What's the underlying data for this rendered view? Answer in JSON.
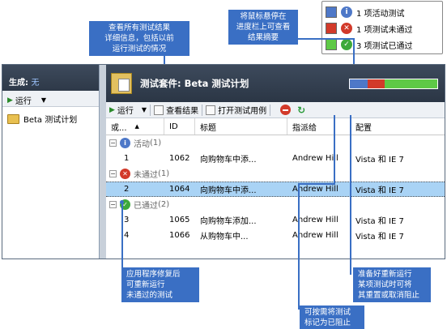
{
  "legend": {
    "items": [
      {
        "label": "1 项活动测试",
        "swatch": "#4e78c8",
        "icon": "i",
        "icon_color": "#4e78c8"
      },
      {
        "label": "1 项测试未通过",
        "swatch": "#d23a2a",
        "icon": "x",
        "icon_color": "#d23a2a"
      },
      {
        "label": "3 项测试已通过",
        "swatch": "#5ec946",
        "icon": "check",
        "icon_color": "#3da93a"
      }
    ]
  },
  "callouts": {
    "view_results": "查看所有测试结果\n详细信息，包括以前\n运行测试的情况",
    "hover_progress": "将鼠标悬停在\n进度栏上可查看\n结果摘要",
    "rerun": "应用程序修复后\n可重新运行\n未通过的测试",
    "blocked": "可按需将测试\n标记为已阻止",
    "reset": "准备好重新运行\n某项测试时可将\n其重置或取消阻止"
  },
  "left": {
    "build_label": "生成:",
    "build_value": "无",
    "run_label": "运行",
    "plan_name": "Beta 测试计划"
  },
  "suite": {
    "title": "测试套件: Beta 测试计划",
    "progress": {
      "active": 1,
      "failed": 1,
      "passed": 3
    }
  },
  "toolbar": {
    "run_label": "运行",
    "view_results_label": "查看结果",
    "open_case_label": "打开测试用例"
  },
  "grid": {
    "columns": [
      "或...",
      "ID",
      "标题",
      "指派给",
      "配置"
    ],
    "groups": [
      {
        "label": "活动",
        "count": "(1)",
        "status": "active",
        "rows": [
          {
            "order": "1",
            "id": "1062",
            "title": "向购物车中添...",
            "assignee": "Andrew Hill",
            "config": "Vista 和 IE 7",
            "selected": false
          }
        ]
      },
      {
        "label": "未通过",
        "count": "(1)",
        "status": "failed",
        "rows": [
          {
            "order": "2",
            "id": "1064",
            "title": "向购物车中添...",
            "assignee": "Andrew Hill",
            "config": "Vista 和 IE 7",
            "selected": true
          }
        ]
      },
      {
        "label": "已通过",
        "count": "(2)",
        "status": "passed",
        "rows": [
          {
            "order": "3",
            "id": "1065",
            "title": "向购物车添加...",
            "assignee": "Andrew Hill",
            "config": "Vista 和 IE 7",
            "selected": false
          },
          {
            "order": "4",
            "id": "1066",
            "title": "从购物车中...",
            "assignee": "Andrew Hill",
            "config": "Vista 和 IE 7",
            "selected": false
          }
        ]
      }
    ]
  }
}
